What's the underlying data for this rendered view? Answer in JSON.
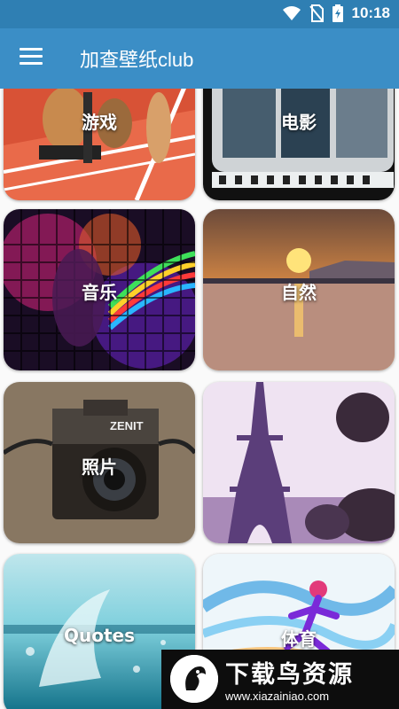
{
  "status_bar": {
    "time": "10:18",
    "icons": [
      "wifi-icon",
      "no-sim-icon",
      "battery-charging-icon"
    ]
  },
  "app_bar": {
    "title": "加查壁纸club",
    "menu_icon": "hamburger-menu-icon"
  },
  "categories": [
    {
      "label": "游戏"
    },
    {
      "label": "电影"
    },
    {
      "label": "音乐"
    },
    {
      "label": "自然"
    },
    {
      "label": "照片"
    },
    {
      "label": "Quotes"
    },
    {
      "label": "体育"
    }
  ],
  "photo_texts": {
    "camera_brand": "ZENIT"
  },
  "watermark": {
    "title": "下载鸟资源",
    "url": "www.xiazainiao.com"
  },
  "colors": {
    "status_bar": "#2f7fb3",
    "app_bar": "#3b8ec6"
  }
}
